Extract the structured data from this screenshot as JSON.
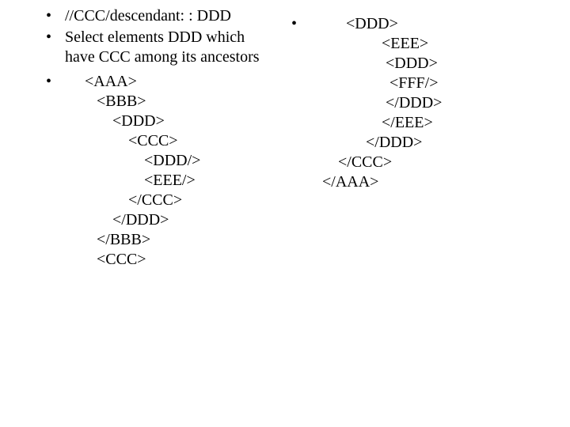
{
  "left": {
    "b1": "//CCC/descendant: : DDD",
    "b2": "Select elements DDD which have CCC among its ancestors",
    "code": "     <AAA>\n        <BBB>\n            <DDD>\n                <CCC>\n                    <DDD/>\n                    <EEE/>\n                </CCC>\n            </DDD>\n        </BBB>\n        <CCC>"
  },
  "right": {
    "code": "         <DDD>\n                  <EEE>\n                   <DDD>\n                    <FFF/>\n                   </DDD>\n                  </EEE>\n              </DDD>\n       </CCC>\n   </AAA>"
  }
}
